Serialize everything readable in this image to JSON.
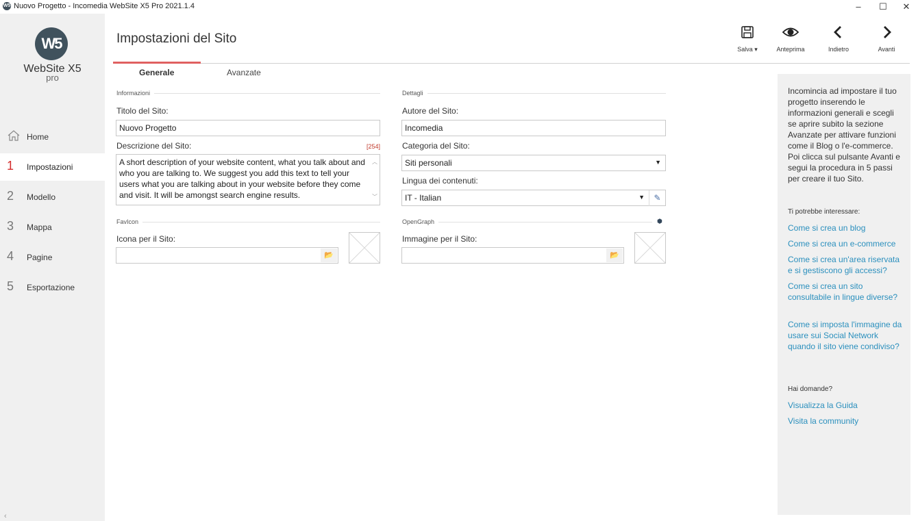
{
  "window": {
    "app_icon": "W5",
    "title": "Nuovo Progetto - Incomedia WebSite X5 Pro 2021.1.4",
    "minimize_icon": "minimize-icon",
    "maximize_icon": "maximize-icon",
    "close_icon": "close-icon"
  },
  "sidebar": {
    "logo_mark": "W5",
    "logo_text": "WebSite X5",
    "logo_sub": "pro",
    "items": [
      {
        "num": "⌂",
        "label": "Home",
        "icon": "home-icon"
      },
      {
        "num": "1",
        "label": "Impostazioni"
      },
      {
        "num": "2",
        "label": "Modello"
      },
      {
        "num": "3",
        "label": "Mappa"
      },
      {
        "num": "4",
        "label": "Pagine"
      },
      {
        "num": "5",
        "label": "Esportazione"
      }
    ],
    "active_index": 1,
    "collapse_glyph": "‹"
  },
  "header": {
    "title": "Impostazioni del Sito"
  },
  "toolbar": {
    "save_label": "Salva ▾",
    "preview_label": "Anteprima",
    "back_label": "Indietro",
    "next_label": "Avanti"
  },
  "tabs": [
    {
      "label": "Generale",
      "active": true
    },
    {
      "label": "Avanzate",
      "active": false
    }
  ],
  "informazioni": {
    "section": "Informazioni",
    "site_title_label": "Titolo del Sito:",
    "site_title_value": "Nuovo Progetto",
    "description_label": "Descrizione del Sito:",
    "description_counter": "[254]",
    "description_value": "A short description of your website content, what you talk about and who you are talking to. We suggest you add  this text to tell your users what you are talking about in your website before they come and visit. It will be amongst search engine results."
  },
  "dettagli": {
    "section": "Dettagli",
    "author_label": "Autore del Sito:",
    "author_value": "Incomedia",
    "category_label": "Categoria del Sito:",
    "category_value": "Siti personali",
    "language_label": "Lingua dei contenuti:",
    "language_value": "IT - Italian"
  },
  "favicon": {
    "section": "FavIcon",
    "label": "Icona per il Sito:",
    "value": ""
  },
  "opengraph": {
    "section": "OpenGraph",
    "label": "Immagine per il Sito:",
    "value": ""
  },
  "help": {
    "intro": "Incomincia ad impostare il tuo progetto inserendo le informazioni generali e scegli se aprire subito la sezione Avanzate per attivare funzioni come il Blog o l'e-commerce. Poi clicca sul pulsante Avanti e segui la procedura in 5 passi per creare il tuo Sito.",
    "interest_heading": "Ti potrebbe interessare:",
    "links": [
      "Come si crea un blog",
      "Come si crea un e-commerce",
      "Come si crea un'area riservata e si gestiscono gli accessi?",
      "Come si crea un sito consultabile in lingue diverse?",
      "Come si imposta l'immagine da usare sui Social Network quando il sito viene condiviso?"
    ],
    "questions_heading": "Hai domande?",
    "support_links": [
      "Visualizza la Guida",
      "Visita la community"
    ]
  },
  "colors": {
    "accent_red": "#d32b2b",
    "link_blue": "#2a8fbd",
    "sidebar_bg": "#f0f0f0"
  }
}
